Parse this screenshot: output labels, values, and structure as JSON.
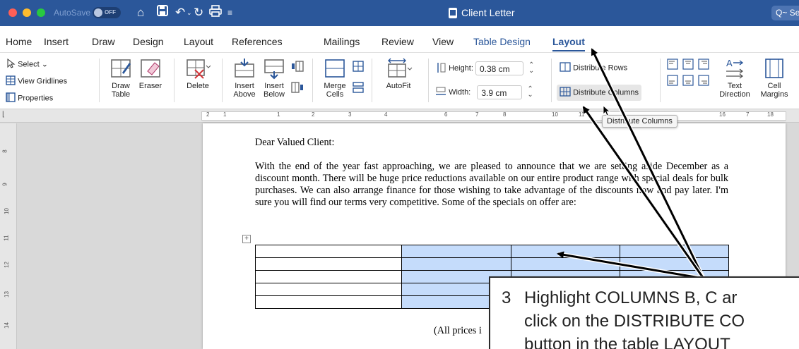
{
  "titlebar": {
    "autosave_label": "AutoSave",
    "autosave_state": "OFF",
    "doc_title": "Client Letter",
    "search_placeholder": "Q~ Se"
  },
  "tabs": [
    {
      "label": "Home"
    },
    {
      "label": "Insert"
    },
    {
      "label": "Draw"
    },
    {
      "label": "Design"
    },
    {
      "label": "Layout"
    },
    {
      "label": "References"
    },
    {
      "label": "Mailings"
    },
    {
      "label": "Review"
    },
    {
      "label": "View"
    },
    {
      "label": "Table Design"
    },
    {
      "label": "Layout"
    }
  ],
  "ribbon": {
    "select": "Select",
    "view_gridlines": "View Gridlines",
    "properties": "Properties",
    "draw_table": "Draw\nTable",
    "eraser": "Eraser",
    "delete": "Delete",
    "insert_above": "Insert\nAbove",
    "insert_below": "Insert\nBelow",
    "merge_cells": "Merge\nCells",
    "autofit": "AutoFit",
    "height_label": "Height:",
    "height_value": "0.38 cm",
    "width_label": "Width:",
    "width_value": "3.9 cm",
    "distribute_rows": "Distribute Rows",
    "distribute_columns": "Distribute Columns",
    "text_direction": "Text\nDirection",
    "cell_margins": "Cell\nMargins"
  },
  "ruler": {
    "h_ticks": [
      "2",
      "1",
      "1",
      "2",
      "3",
      "4",
      "6",
      "7",
      "8",
      "10",
      "11",
      "16",
      "7",
      "18"
    ],
    "v_ticks": [
      "8",
      "9",
      "10",
      "11",
      "12",
      "13",
      "14"
    ]
  },
  "tooltip": "Distribute Columns",
  "document": {
    "greeting": "Dear Valued Client:",
    "paragraph": "With the end of the year fast approaching, we are pleased to announce that we are setting aside December as a discount month.  There will be huge price reductions available on our entire product range with special deals for bulk purchases.  We can also arrange finance for those wishing to take advantage of the discounts now and pay later.  I'm sure you will find our terms very competitive.  Some of the specials on offer are:",
    "prices_note": "(All prices i",
    "table": {
      "rows": 5,
      "cols": 4,
      "selected_columns": [
        "B",
        "C",
        "D"
      ]
    }
  },
  "callout": {
    "step": "3",
    "text": "Highlight COLUMNS B, C ar\nclick on the DISTRIBUTE CO\nbutton in the table LAYOUT"
  },
  "colors": {
    "title_bar": "#2b579a",
    "selection": "#c5dcfb",
    "accent": "#2b579a"
  }
}
